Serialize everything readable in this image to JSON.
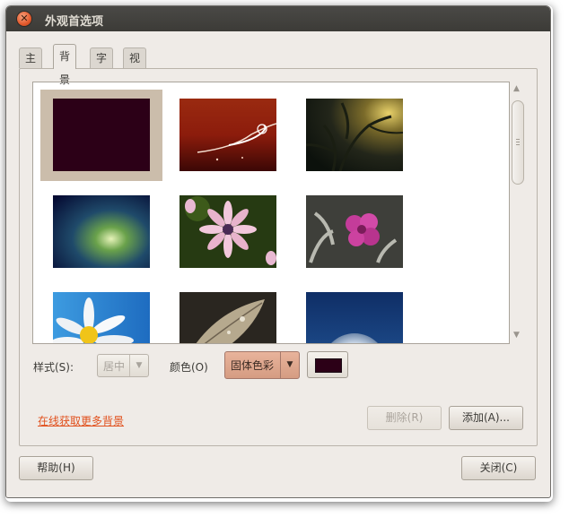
{
  "window": {
    "title": "外观首选项",
    "close_glyph": "✕"
  },
  "tabs": [
    {
      "label": "主题",
      "active": false
    },
    {
      "label": "背景",
      "active": true
    },
    {
      "label": "字体",
      "active": false
    },
    {
      "label": "视觉效果",
      "active": false
    }
  ],
  "gallery": {
    "selected_color": "#2c0017",
    "wallpapers": [
      {
        "name": "solid-plum",
        "selected": true
      },
      {
        "name": "red-swirl",
        "selected": false
      },
      {
        "name": "tree-light",
        "selected": false
      },
      {
        "name": "blue-green-light",
        "selected": false
      },
      {
        "name": "pink-daisy",
        "selected": false
      },
      {
        "name": "pink-flower",
        "selected": false
      },
      {
        "name": "white-daisy",
        "selected": false
      },
      {
        "name": "dry-leaf",
        "selected": false
      },
      {
        "name": "dandelion",
        "selected": false
      }
    ]
  },
  "style": {
    "label": "样式(S):",
    "value": "居中"
  },
  "color": {
    "label": "颜色(O)",
    "value": "固体色彩",
    "swatch": "#2c0017"
  },
  "links": {
    "more_backgrounds": "在线获取更多背景"
  },
  "buttons": {
    "remove": "删除(R)",
    "add": "添加(A)...",
    "help": "帮助(H)",
    "close": "关闭(C)"
  },
  "icons": {
    "dropdown": "▼",
    "scroll_up": "▲",
    "scroll_down": "▼"
  }
}
